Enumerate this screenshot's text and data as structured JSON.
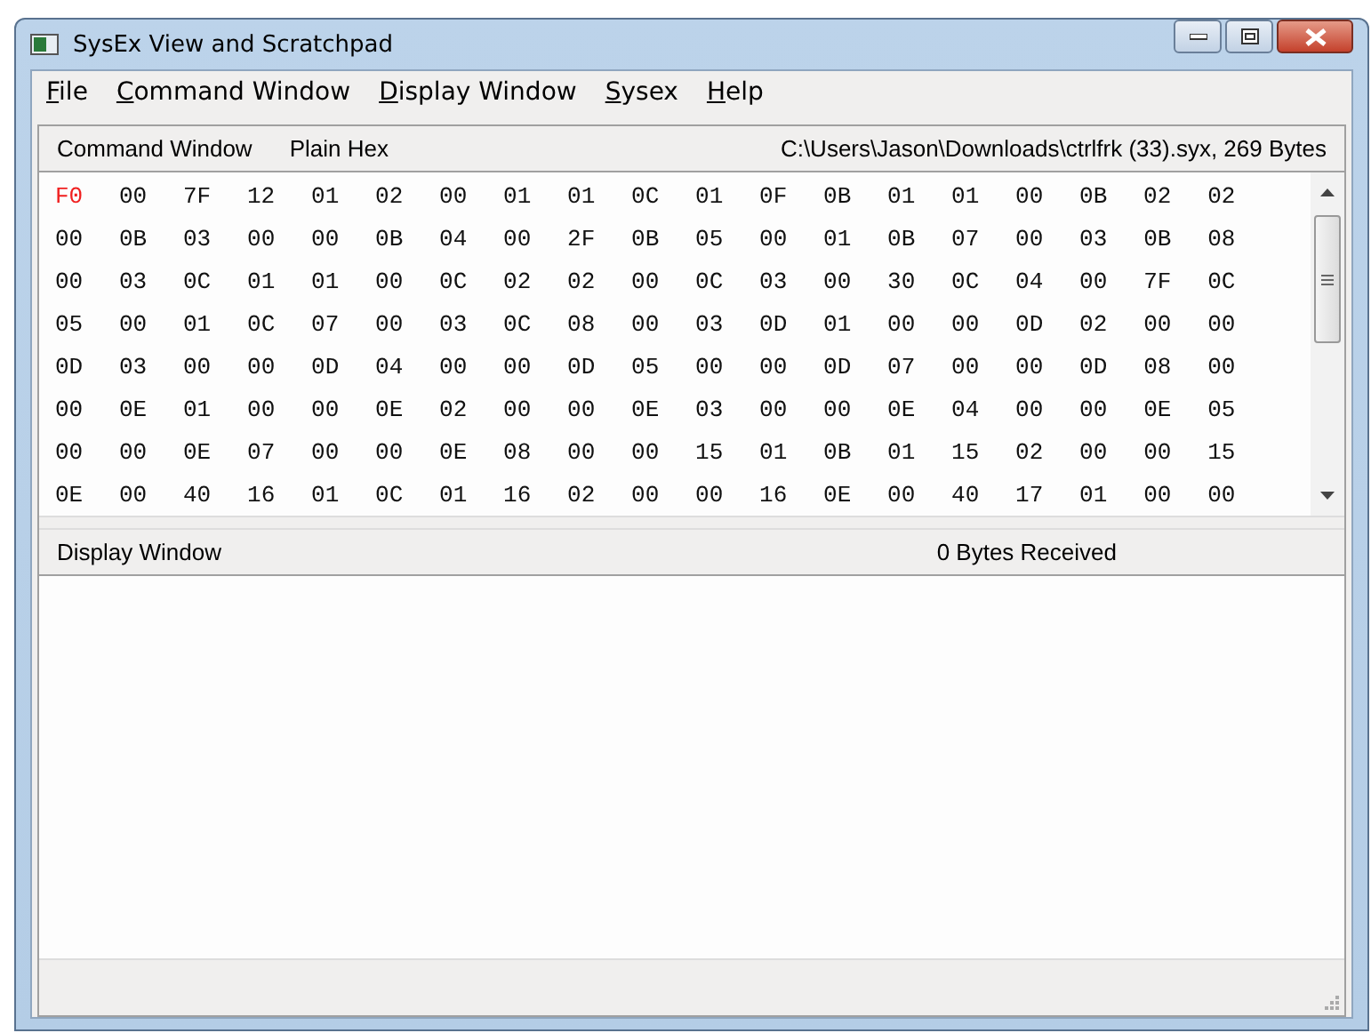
{
  "window": {
    "title": "SysEx View and Scratchpad"
  },
  "menu": [
    "File",
    "Command Window",
    "Display Window",
    "Sysex",
    "Help"
  ],
  "command_header": {
    "title": "Command Window",
    "format": "Plain Hex",
    "file": "C:\\Users\\Jason\\Downloads\\ctrlfrk (33).syx,  269 Bytes"
  },
  "hex": {
    "start_byte": "F0",
    "rows": [
      "00 7F 12 01 02 00 01 01 0C 01 0F 0B 01 01 00 0B 02 02",
      "00 0B 03 00 00 0B 04 00 2F 0B 05 00 01 0B 07 00 03 0B 08",
      "00 03 0C 01 01 00 0C 02 02 00 0C 03 00 30 0C 04 00 7F 0C",
      "05 00 01 0C 07 00 03 0C 08 00 03 0D 01 00 00 0D 02 00 00",
      "0D 03 00 00 0D 04 00 00 0D 05 00 00 0D 07 00 00 0D 08 00",
      "00 0E 01 00 00 0E 02 00 00 0E 03 00 00 0E 04 00 00 0E 05",
      "00 00 0E 07 00 00 0E 08 00 00 15 01 0B 01 15 02 00 00 15",
      "0E 00 40 16 01 0C 01 16 02 00 00 16 0E 00 40 17 01 00 00"
    ]
  },
  "display_header": {
    "title": "Display Window",
    "received": "0  Bytes Received"
  }
}
